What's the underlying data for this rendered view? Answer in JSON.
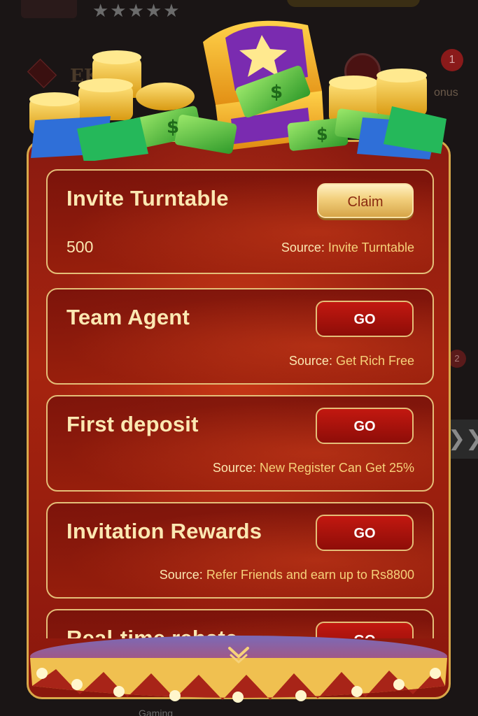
{
  "background": {
    "stars": "★★★★★",
    "brand": "EK    OM",
    "badge_count": "1",
    "bonus_label": "onus",
    "badge2_count": "2",
    "chevron": "❯❯",
    "gaming_label": "Gaming"
  },
  "rewards": [
    {
      "title": "Invite Turntable",
      "button": "Claim",
      "button_type": "claim",
      "amount": "500",
      "source_label": "Source: ",
      "source_value": "Invite Turntable"
    },
    {
      "title": "Team Agent",
      "button": "GO",
      "button_type": "go",
      "source_label": "Source: ",
      "source_value": "Get Rich Free"
    },
    {
      "title": "First deposit",
      "button": "GO",
      "button_type": "go",
      "source_label": "Source: ",
      "source_value": "New Register Can Get 25%"
    },
    {
      "title": "Invitation Rewards",
      "button": "GO",
      "button_type": "go",
      "source_label": "Source: ",
      "source_value": "Refer Friends and earn up to Rs8800"
    },
    {
      "title": "Real-time rebate",
      "button": "GO",
      "button_type": "go"
    }
  ],
  "colors": {
    "accent_gold": "#e4be78",
    "panel_red": "#a6240f",
    "go_button": "#c21810",
    "claim_button": "#f2cf7c",
    "text_cream": "#fbe8b2",
    "source_value": "#f6d27a"
  },
  "icons": {
    "header_art": "treasure-chest-icon",
    "collapse": "chevron-down-icon"
  }
}
